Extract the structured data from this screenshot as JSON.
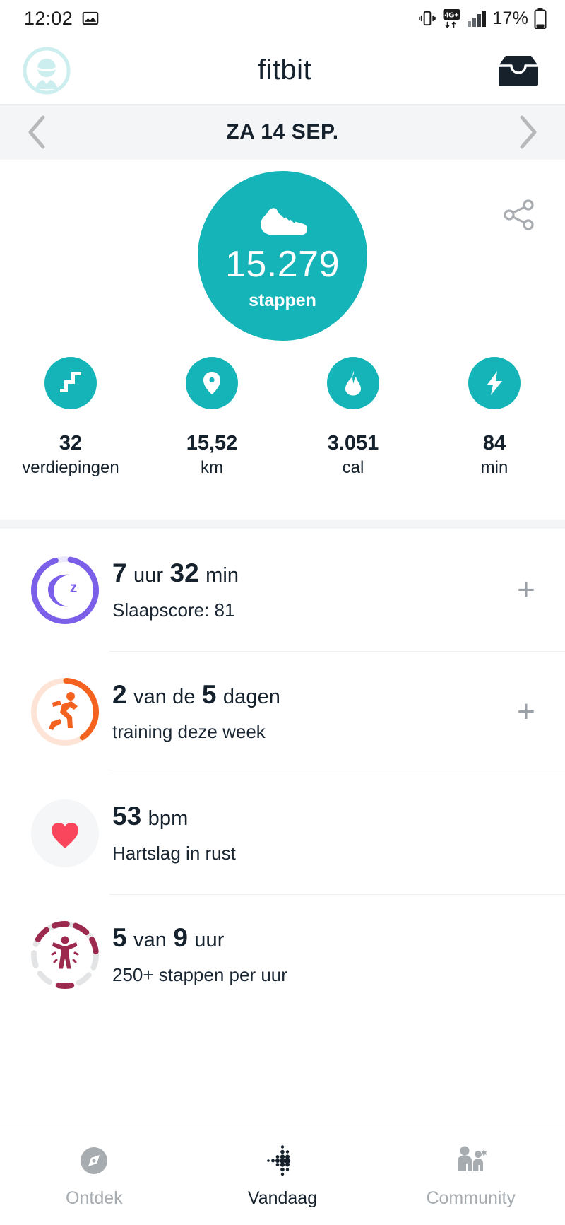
{
  "status_bar": {
    "time": "12:02",
    "battery_percent": "17%",
    "network": "4G+",
    "icons": [
      "image-icon",
      "vibrate-icon",
      "network-4g-plus-icon",
      "signal-bars-icon",
      "battery-icon"
    ]
  },
  "app_header": {
    "brand": "fitbit",
    "avatar_name": "avatar",
    "inbox_name": "inbox-icon"
  },
  "date_bar": {
    "label": "ZA 14 SEP.",
    "prev_name": "chevron-left-icon",
    "next_name": "chevron-right-icon"
  },
  "hero": {
    "steps_value": "15.279",
    "steps_label": "stappen",
    "share_label": "share-icon",
    "accent_color": "#15b4b9",
    "stats": [
      {
        "icon": "stairs-icon",
        "value": "32",
        "unit": "verdiepingen"
      },
      {
        "icon": "location-pin-icon",
        "value": "15,52",
        "unit": "km"
      },
      {
        "icon": "flame-icon",
        "value": "3.051",
        "unit": "cal"
      },
      {
        "icon": "lightning-bolt-icon",
        "value": "84",
        "unit": "min"
      }
    ]
  },
  "tiles": [
    {
      "name": "sleep",
      "icon": "moon-sleep-icon",
      "ring_color": "#7b5fe8",
      "ring_track": "#ece8fd",
      "title_value": "7",
      "title_unit": "uur",
      "title_value2": "32",
      "title_unit2": "min",
      "subtitle": "Slaapscore: 81",
      "has_plus": true,
      "plus_label": "+"
    },
    {
      "name": "exercise",
      "icon": "running-person-icon",
      "ring_color": "#f4621f",
      "ring_track": "#fde4d6",
      "title_value": "2",
      "title_unit": "van de",
      "title_value2": "5",
      "title_unit2": "dagen",
      "subtitle": "training deze week",
      "has_plus": true,
      "plus_label": "+"
    },
    {
      "name": "resting-heart-rate",
      "icon": "heart-icon",
      "ring_color": "#f9465c",
      "ring_track": "#f4f5f6",
      "title_value": "53",
      "title_unit": "bpm",
      "title_value2": "",
      "title_unit2": "",
      "subtitle": "Hartslag in rust",
      "has_plus": false,
      "plus_label": ""
    },
    {
      "name": "hourly-activity",
      "icon": "standing-person-icon",
      "ring_color": "#9c2a4e",
      "ring_track": "#e3e4e6",
      "title_value": "5",
      "title_unit": "van",
      "title_value2": "9",
      "title_unit2": "uur",
      "subtitle": "250+ stappen per uur",
      "has_plus": false,
      "plus_label": ""
    }
  ],
  "bottom_nav": {
    "items": [
      {
        "name": "ontdek",
        "label": "Ontdek",
        "icon": "compass-icon",
        "active": false
      },
      {
        "name": "vandaag",
        "label": "Vandaag",
        "icon": "fitbit-dots-icon",
        "active": true
      },
      {
        "name": "community",
        "label": "Community",
        "icon": "people-icon",
        "active": false
      }
    ]
  }
}
